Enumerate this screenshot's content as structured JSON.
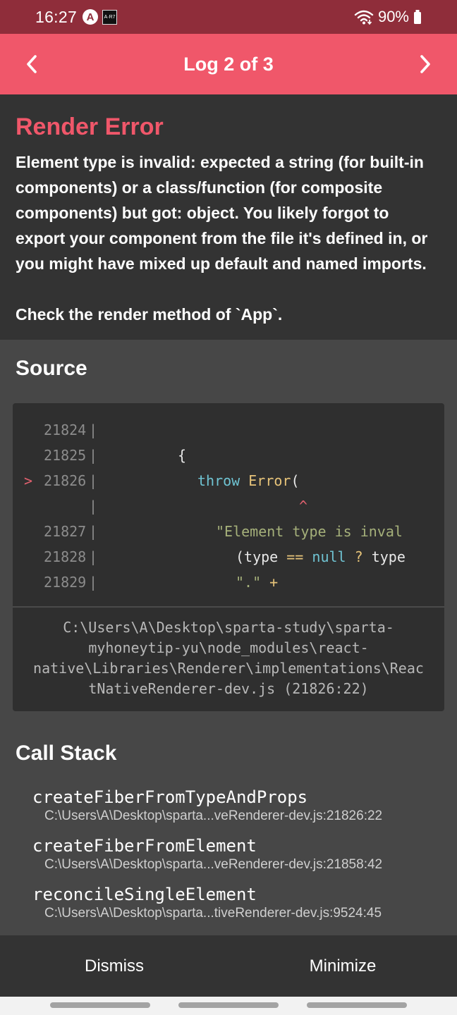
{
  "status": {
    "time": "16:27",
    "battery": "90%",
    "icons": [
      "app-a-icon",
      "app-square-icon",
      "wifi-icon",
      "battery-icon"
    ]
  },
  "header": {
    "title": "Log 2 of 3",
    "prev_icon": "chevron-left-icon",
    "next_icon": "chevron-right-icon",
    "bg_color": "#f0576a"
  },
  "error": {
    "title": "Render Error",
    "message": "Element type is invalid: expected a string (for built-in components) or a class/function (for composite components) but got: object. You likely forgot to export your component from the file it's defined in, or you might have mixed up default and named imports.\n\nCheck the render method of `App`."
  },
  "source": {
    "heading": "Source",
    "lines": [
      {
        "marker": "",
        "num": "21824",
        "bar": "|"
      },
      {
        "marker": "",
        "num": "21825",
        "bar": "|"
      },
      {
        "marker": ">",
        "num": "21826",
        "bar": "|"
      },
      {
        "marker": "",
        "num": "",
        "bar": "|"
      },
      {
        "marker": "",
        "num": "21827",
        "bar": "|"
      },
      {
        "marker": "",
        "num": "21828",
        "bar": "|"
      },
      {
        "marker": "",
        "num": "21829",
        "bar": "|"
      }
    ],
    "code": {
      "line2_brace": "{",
      "line3_kw": "throw",
      "line3_fn": "Error",
      "line3_paren": "(",
      "line4_caret": "^",
      "line5_str": "\"Element type is inval",
      "line6_open": "(type",
      "line6_op": "==",
      "line6_null": "null",
      "line6_q": "?",
      "line6_type": "type",
      "line7_str": "\".\"",
      "line7_plus": "+"
    },
    "file_path": "C:\\Users\\A\\Desktop\\sparta-study\\sparta-\nmyhoneytip-yu\\node_modules\\react-\nnative\\Libraries\\Renderer\\implementations\\Reac\ntNativeRenderer-dev.js (21826:22)"
  },
  "call_stack": {
    "heading": "Call Stack",
    "frames": [
      {
        "name": "createFiberFromTypeAndProps",
        "location": "C:\\Users\\A\\Desktop\\sparta...veRenderer-dev.js:21826:22"
      },
      {
        "name": "createFiberFromElement",
        "location": "C:\\Users\\A\\Desktop\\sparta...veRenderer-dev.js:21858:42"
      },
      {
        "name": "reconcileSingleElement",
        "location": "C:\\Users\\A\\Desktop\\sparta...tiveRenderer-dev.js:9524:45"
      }
    ]
  },
  "footer": {
    "dismiss_label": "Dismiss",
    "minimize_label": "Minimize"
  }
}
